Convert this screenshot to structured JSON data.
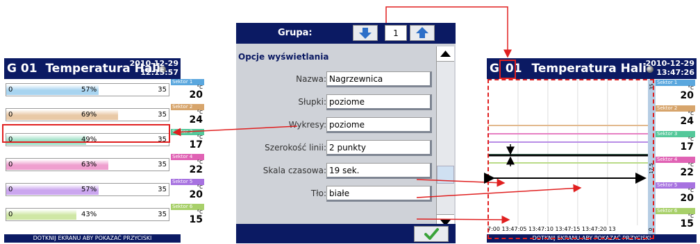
{
  "left_panel": {
    "header": {
      "group": "G 01",
      "title": "Temperatura Hali",
      "date": "2010-12-29",
      "time": "12:15:57"
    },
    "bars": [
      {
        "min": "0",
        "percent": "57%",
        "fill": 0.57,
        "max": "35",
        "color": "#a8d4f0"
      },
      {
        "min": "0",
        "percent": "69%",
        "fill": 0.69,
        "max": "35",
        "color": "#e9c9a6"
      },
      {
        "min": "0",
        "percent": "49%",
        "fill": 0.49,
        "max": "35",
        "color": "#9fe0c6"
      },
      {
        "min": "0",
        "percent": "63%",
        "fill": 0.63,
        "max": "35",
        "color": "#ef9fcf"
      },
      {
        "min": "0",
        "percent": "57%",
        "fill": 0.57,
        "max": "35",
        "color": "#cba6ef"
      },
      {
        "min": "0",
        "percent": "43%",
        "fill": 0.43,
        "max": "35",
        "color": "#cfe7a5"
      }
    ],
    "sectors": [
      {
        "name": "Sektor 1",
        "unit": "°C",
        "value": "20",
        "color": "#5aa7de"
      },
      {
        "name": "Sektor 2",
        "unit": "°C",
        "value": "24",
        "color": "#d7a56c"
      },
      {
        "name": "Sektor 3",
        "unit": "°C",
        "value": "17",
        "color": "#54c89a"
      },
      {
        "name": "Sektor 4",
        "unit": "°C",
        "value": "22",
        "color": "#e062b4"
      },
      {
        "name": "Sektor 5",
        "unit": "°C",
        "value": "20",
        "color": "#a772e0"
      },
      {
        "name": "Sektor 6",
        "unit": "°C",
        "value": "15",
        "color": "#a8d06a"
      }
    ],
    "footer": "DOTKNIJ EKRANU ABY POKAZAĆ PRZYCISKI"
  },
  "middle_panel": {
    "group_label": "Grupa:",
    "group_number": "1",
    "section_title": "Opcje wyświetlania",
    "options": [
      {
        "label": "Nazwa:",
        "value": "Nagrzewnica"
      },
      {
        "label": "Słupki:",
        "value": "poziome"
      },
      {
        "label": "Wykresy:",
        "value": "poziome"
      },
      {
        "label": "Szerokość linii:",
        "value": "2 punkty"
      },
      {
        "label": "Skala czasowa:",
        "value": "19 sek."
      },
      {
        "label": "Tło:",
        "value": "białe"
      }
    ]
  },
  "right_panel": {
    "header": {
      "group_prefix": "G",
      "group_number": "01",
      "title": "Temperatura Hali",
      "date": "2010-12-29",
      "time": "13:47:26"
    },
    "scale_labels": {
      "top": "35",
      "mid": "17.5",
      "bottom": "0"
    },
    "time_axis": "7:00   13:47:05   13:47:10   13:47:15   13:47:20   13",
    "footer": "DOTKNIJ EKRANU ABY POKAZAĆ PRZYCISKI",
    "trend_lines": [
      {
        "name": "Sektor 1",
        "value": 20,
        "color": "#8ec2ea"
      },
      {
        "name": "Sektor 2",
        "value": 24,
        "color": "#e2b98d"
      },
      {
        "name": "Sektor 3",
        "value": 17,
        "color": "#7ad6ae"
      },
      {
        "name": "Sektor 4",
        "value": 22,
        "color": "#e67fc2"
      },
      {
        "name": "Sektor 5",
        "value": 20,
        "color": "#b88ce6"
      },
      {
        "name": "Sektor 6",
        "value": 15,
        "color": "#b9db86"
      }
    ]
  },
  "colors": {
    "header_bg": "#0b1a63",
    "highlight": "#e01f1f",
    "button_blue": "#2d6fc8",
    "ok_green": "#3aa33a"
  }
}
